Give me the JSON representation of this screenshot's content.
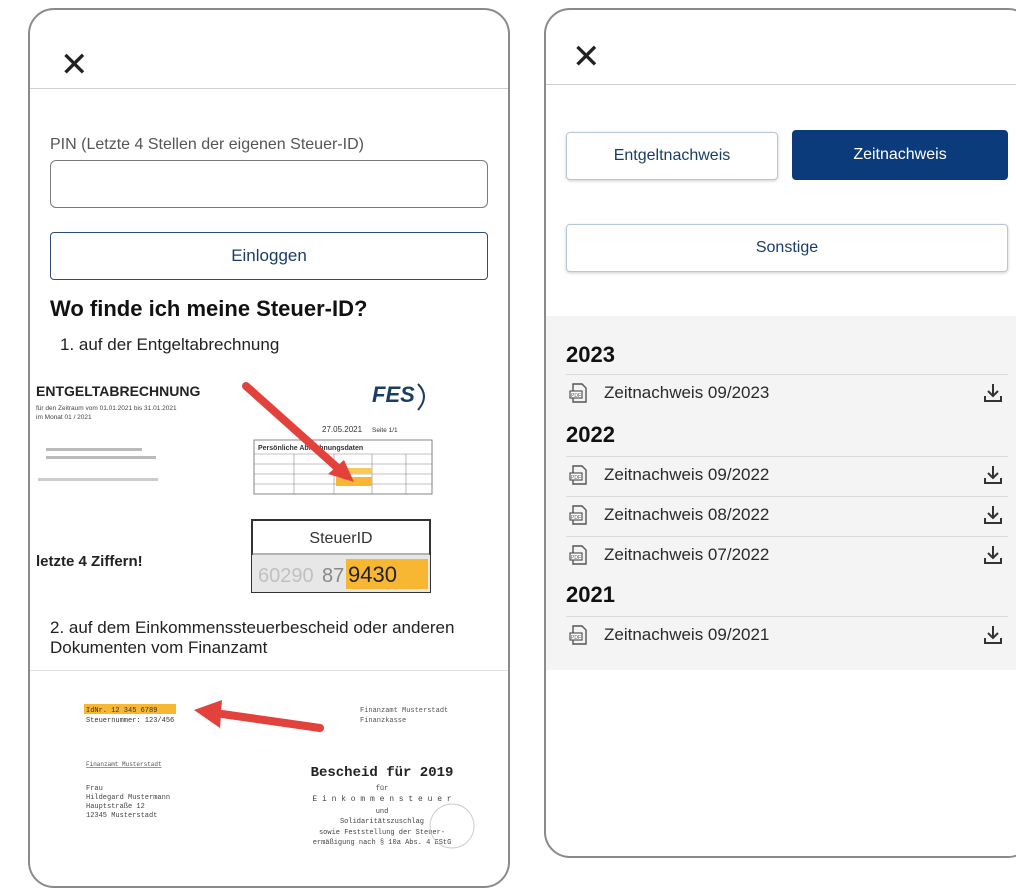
{
  "left": {
    "close_glyph": "✕",
    "pin_label": "PIN (Letzte 4 Stellen der eigenen Steuer-ID)",
    "pin_value": "",
    "login_label": "Einloggen",
    "faq_title": "Wo finde ich meine Steuer-ID?",
    "step1": "1.  auf der Entgeltabrechnung",
    "step2": "2.  auf dem Einkommenssteuerbescheid oder anderen Dokumenten vom Finanzamt",
    "doc1": {
      "heading": "ENTGELTABRECHNUNG",
      "period": "für den Zeitraum vom 01.01.2021 bis 31.01.2021",
      "month": "im Monat 01 / 2021",
      "logo": "FES",
      "date": "27.05.2021",
      "page": "Seite 1/1",
      "table_title": "Persönliche Abrechnungsdaten",
      "hint": "letzte 4 Ziffern!",
      "steuerid_title": "SteuerID",
      "steuerid_prefix": "60290",
      "steuerid_mid": "87",
      "steuerid_suffix": "9430"
    },
    "doc2": {
      "idnr": "IdNr. 12 345 6789",
      "steuernummer": "Steuernummer: 123/456",
      "office": "Finanzamt Musterstadt",
      "office_sub": "Finanzkasse",
      "sender": "Finanzamt Musterstadt",
      "addr1": "Frau",
      "addr2": "Hildegard Mustermann",
      "addr3": "Hauptstraße 12",
      "addr4": "12345 Musterstadt",
      "title": "Bescheid für 2019",
      "l1": "für",
      "l2": "E i n k o m m e n s t e u e r",
      "l3": "und",
      "l4": "Solidaritätszuschlag",
      "l5": "sowie Feststellung der Steuer-",
      "l6": "ermäßigung nach § 10a Abs. 4 EStG"
    }
  },
  "right": {
    "close_glyph": "✕",
    "tabs": {
      "entgelt": "Entgeltnachweis",
      "zeit": "Zeitnachweis",
      "sonstige": "Sonstige"
    },
    "groups": [
      {
        "year": "2023",
        "items": [
          "Zeitnachweis 09/2023"
        ]
      },
      {
        "year": "2022",
        "items": [
          "Zeitnachweis 09/2022",
          "Zeitnachweis 08/2022",
          "Zeitnachweis 07/2022"
        ]
      },
      {
        "year": "2021",
        "items": [
          "Zeitnachweis 09/2021"
        ]
      }
    ]
  },
  "colors": {
    "primary": "#0b3b7a",
    "arrow": "#e2413c",
    "highlight": "#f7b733"
  }
}
